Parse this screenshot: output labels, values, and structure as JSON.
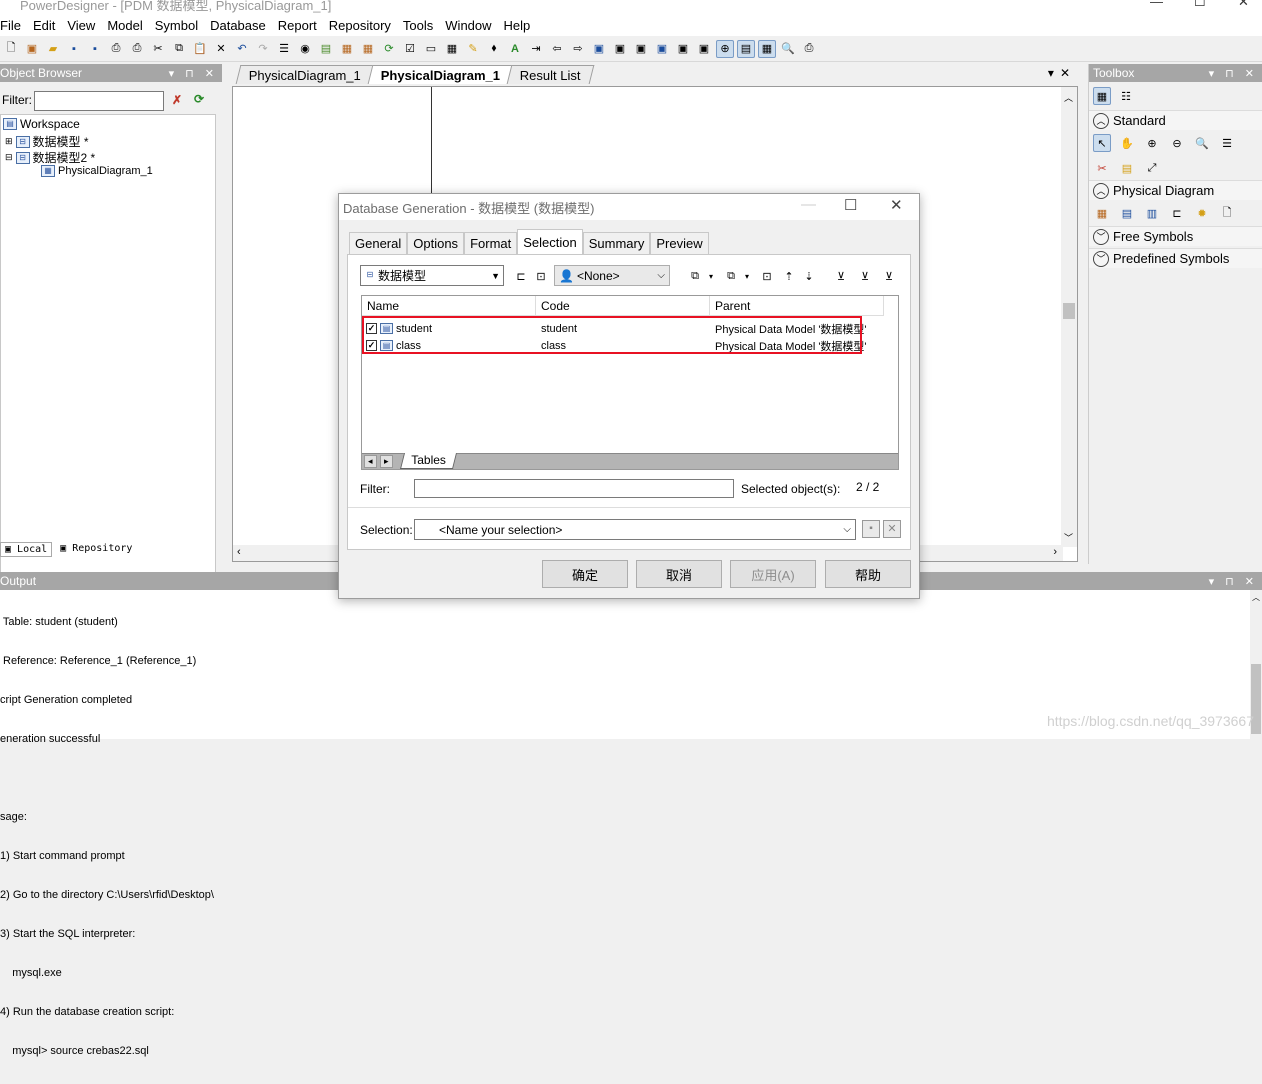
{
  "window": {
    "title": "PowerDesigner - [PDM 数据模型, PhysicalDiagram_1]"
  },
  "menu": [
    "File",
    "Edit",
    "View",
    "Model",
    "Symbol",
    "Database",
    "Report",
    "Repository",
    "Tools",
    "Window",
    "Help"
  ],
  "object_browser": {
    "title": "Object Browser",
    "filter_label": "Filter:",
    "tree": {
      "workspace": "Workspace",
      "model1": "数据模型 *",
      "model2": "数据模型2 *",
      "diagram": "PhysicalDiagram_1"
    },
    "tabs": {
      "local": "Local",
      "repository": "Repository"
    }
  },
  "diagram_tabs": [
    {
      "label": "PhysicalDiagram_1",
      "active": false
    },
    {
      "label": "PhysicalDiagram_1",
      "active": true
    },
    {
      "label": "Result List",
      "active": false
    }
  ],
  "toolbox": {
    "title": "Toolbox",
    "sections": {
      "standard": "Standard",
      "physical": "Physical Diagram",
      "free": "Free Symbols",
      "predefined": "Predefined Symbols"
    }
  },
  "output": {
    "title": "Output",
    "lines": [
      " Table: student (student)",
      " Reference: Reference_1 (Reference_1)",
      "cript Generation completed",
      "eneration successful",
      "",
      "sage:",
      "1) Start command prompt",
      "2) Go to the directory C:\\Users\\rfid\\Desktop\\",
      "3) Start the SQL interpreter:",
      "    mysql.exe",
      "4) Run the database creation script:",
      "    mysql> source crebas22.sql"
    ],
    "watermark": "https://blog.csdn.net/qq_3973667"
  },
  "dialog": {
    "title": "Database Generation - 数据模型 (数据模型)",
    "tabs": [
      {
        "label": "General",
        "active": false
      },
      {
        "label": "Options",
        "active": false
      },
      {
        "label": "Format",
        "active": false
      },
      {
        "label": "Selection",
        "active": true
      },
      {
        "label": "Summary",
        "active": false
      },
      {
        "label": "Preview",
        "active": false
      }
    ],
    "model_select": "数据模型",
    "owner_select": "<None>",
    "columns": {
      "name": "Name",
      "code": "Code",
      "parent": "Parent"
    },
    "rows": [
      {
        "name": "student",
        "code": "student",
        "parent": "Physical Data Model '数据模型'",
        "checked": true
      },
      {
        "name": "class",
        "code": "class",
        "parent": "Physical Data Model '数据模型'",
        "checked": true
      }
    ],
    "sheet_tab": "Tables",
    "filter_label": "Filter:",
    "filter_value": "",
    "selected_label": "Selected object(s):",
    "selected_count": "2 / 2",
    "selection_label": "Selection:",
    "selection_placeholder": "<Name your selection>",
    "buttons": {
      "ok": "确定",
      "cancel": "取消",
      "apply": "应用(A)",
      "help": "帮助"
    }
  },
  "colors": {
    "highlight_box": "#e81123",
    "panel_header": "#a6a6a6",
    "accent": "#2d55a0"
  }
}
